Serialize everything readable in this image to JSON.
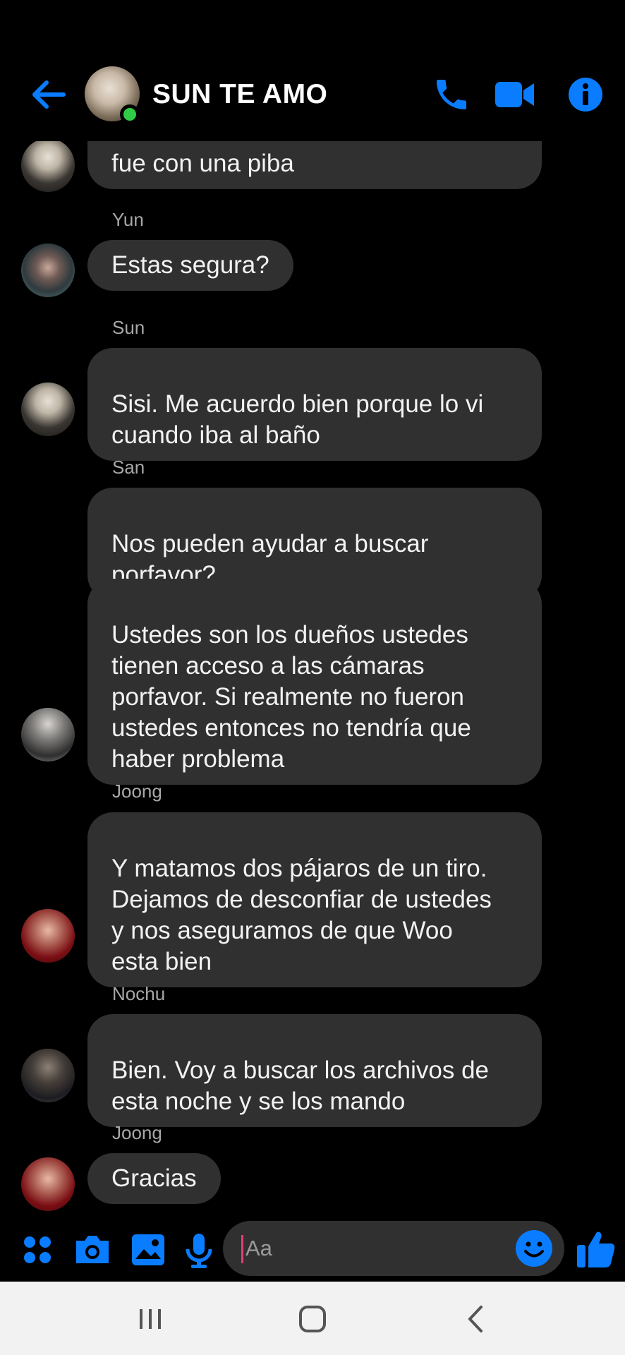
{
  "header": {
    "title": "SUN TE AMO",
    "back_icon": "arrow-left-icon",
    "call_icon": "phone-icon",
    "video_icon": "video-camera-icon",
    "info_icon": "info-icon",
    "accent_color": "#0a7cff",
    "online_color": "#31cc46"
  },
  "messages": {
    "m0": {
      "text": "fue con una piba"
    },
    "m1": {
      "sender": "Yun",
      "text": "Estas segura?"
    },
    "m2": {
      "sender": "Sun",
      "text": "Sisi. Me acuerdo bien porque lo vi\ncuando iba al baño"
    },
    "m3": {
      "sender": "San",
      "text": "Nos pueden ayudar a buscar\nporfavor?"
    },
    "m4": {
      "text": "Ustedes son los dueños ustedes\ntienen acceso a las cámaras\nporfavor. Si realmente no fueron\nustedes entonces no tendría que\nhaber problema"
    },
    "m5": {
      "sender": "Joong",
      "text": "Y matamos dos pájaros de un tiro.\nDejamos de desconfiar de ustedes\ny nos aseguramos de que Woo\nesta bien"
    },
    "m6": {
      "sender": "Nochu",
      "text": "Bien. Voy a buscar los archivos de\nesta noche y se los mando"
    },
    "m7": {
      "sender": "Joong",
      "text": "Gracias"
    }
  },
  "composer": {
    "placeholder": "Aa",
    "value": "",
    "icons": [
      "apps-grid-icon",
      "camera-icon",
      "gallery-icon",
      "microphone-icon",
      "emoji-icon",
      "thumbs-up-icon"
    ]
  },
  "navbar": {
    "icons": [
      "recent-apps-icon",
      "home-icon",
      "back-icon"
    ]
  }
}
